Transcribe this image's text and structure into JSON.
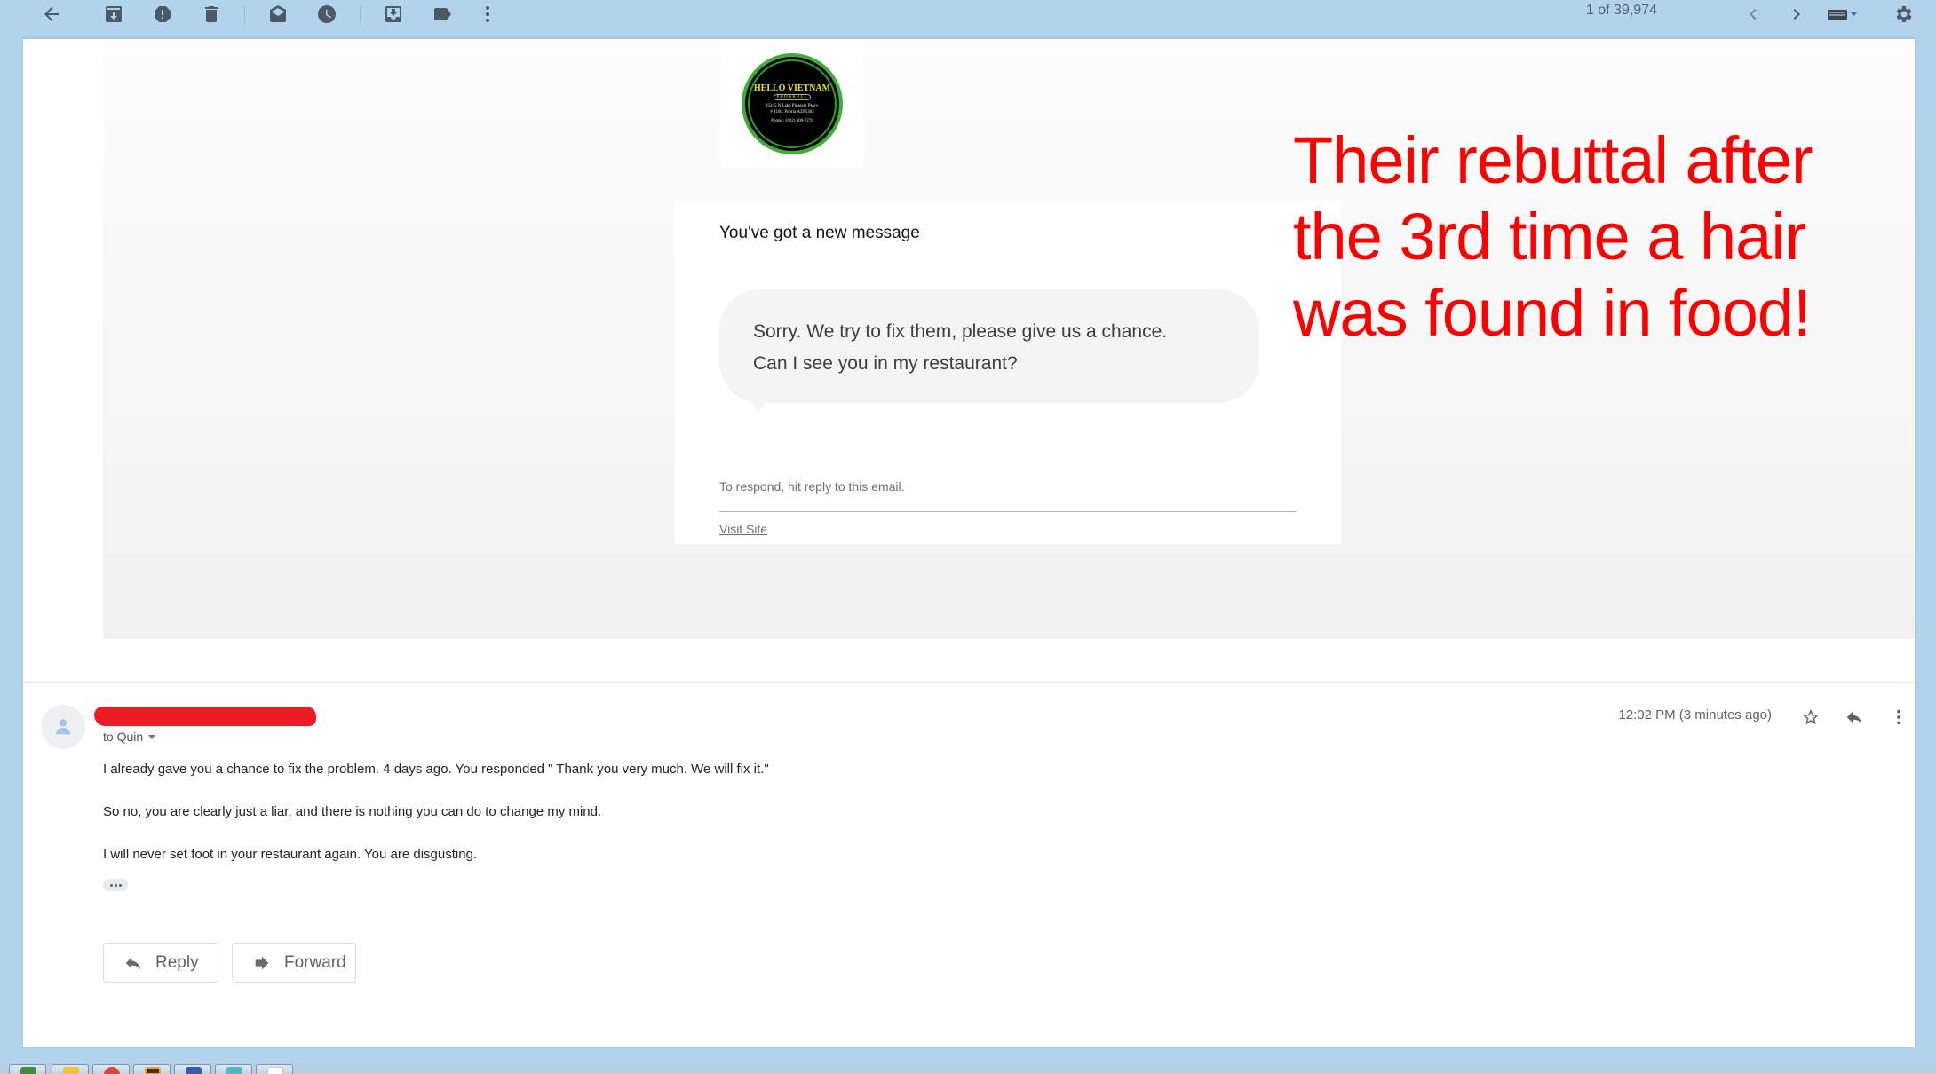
{
  "toolbar": {
    "icons": [
      {
        "name": "back-arrow-icon",
        "label": "Back"
      },
      {
        "name": "archive-icon",
        "label": "Archive"
      },
      {
        "name": "report-spam-icon",
        "label": "Report spam"
      },
      {
        "name": "delete-icon",
        "label": "Delete"
      },
      {
        "name": "mark-unread-icon",
        "label": "Mark as unread"
      },
      {
        "name": "snooze-icon",
        "label": "Snooze"
      },
      {
        "name": "move-to-icon",
        "label": "Move to"
      },
      {
        "name": "label-icon",
        "label": "Labels"
      },
      {
        "name": "more-options-icon",
        "label": "More"
      }
    ],
    "pager": "1 of 39,974",
    "right_icons": [
      {
        "name": "chevron-left-icon",
        "label": "Newer"
      },
      {
        "name": "chevron-right-icon",
        "label": "Older"
      },
      {
        "name": "keyboard-icon",
        "label": "Input tools"
      },
      {
        "name": "gear-icon",
        "label": "Settings"
      }
    ]
  },
  "email": {
    "logo": {
      "title": "HELLO VIETNAM",
      "subtitle": "PHO&ROLL",
      "address_line1": "25245 N Lake Pleasant Pkwy.",
      "address_line2": "# 1100. Peoria.AZ85383",
      "phone": "Phone : (602) 600-7278"
    },
    "card": {
      "heading": "You've got a new message",
      "bubble_line1": "Sorry. We try to fix them, please give us a chance.",
      "bubble_line2": "Can I see you in my restaurant?",
      "hint": "To respond, hit reply to this email.",
      "link": "Visit Site"
    }
  },
  "annotation": {
    "text": "Their rebuttal after\nthe 3rd time a hair\nwas found in food!",
    "color": "#ff0000"
  },
  "reply_message": {
    "sender": "[redacted]",
    "to": "to Quin",
    "time": "12:02 PM (3 minutes ago)",
    "body": [
      "I already gave you a chance to fix the problem. 4 days ago. You responded \" Thank you very much. We will fix it.\"",
      "So no, you are clearly just a liar, and there is nothing you can do to change my mind.",
      "I will never set foot in your restaurant again. You are disgusting."
    ]
  },
  "actions": {
    "reply": "Reply",
    "forward": "Forward"
  },
  "colors": {
    "chrome_bg": "#b1d3ec",
    "redaction": "#ed1c24",
    "icon_gray": "#5f6368"
  }
}
